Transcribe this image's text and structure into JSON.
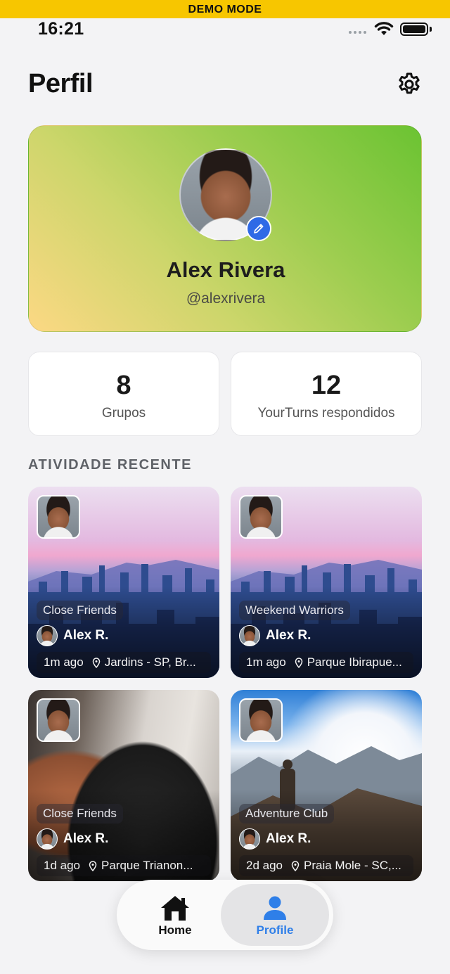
{
  "demo_banner": "DEMO MODE",
  "status_bar": {
    "time": "16:21"
  },
  "header": {
    "title": "Perfil",
    "settings_icon": "gear-icon"
  },
  "profile": {
    "name": "Alex Rivera",
    "handle": "@alexrivera",
    "edit_icon": "pencil-icon",
    "gradient_colors": [
      "#fcd884",
      "#6bc332"
    ]
  },
  "stats": [
    {
      "value": "8",
      "label": "Grupos"
    },
    {
      "value": "12",
      "label": "YourTurns respondidos"
    }
  ],
  "recent_activity": {
    "title": "ATIVIDADE RECENTE",
    "items": [
      {
        "group": "Close Friends",
        "author": "Alex R.",
        "time": "1m ago",
        "location": "Jardins - SP, Br..."
      },
      {
        "group": "Weekend Warriors",
        "author": "Alex R.",
        "time": "1m ago",
        "location": "Parque Ibirapue..."
      },
      {
        "group": "Close Friends",
        "author": "Alex R.",
        "time": "1d ago",
        "location": "Parque Trianon..."
      },
      {
        "group": "Adventure Club",
        "author": "Alex R.",
        "time": "2d ago",
        "location": "Praia Mole - SC,..."
      }
    ]
  },
  "bottom_nav": {
    "items": [
      {
        "label": "Home",
        "icon": "home-icon"
      },
      {
        "label": "Profile",
        "icon": "person-icon"
      }
    ],
    "active": "Profile",
    "active_color": "#2f7fe8"
  }
}
